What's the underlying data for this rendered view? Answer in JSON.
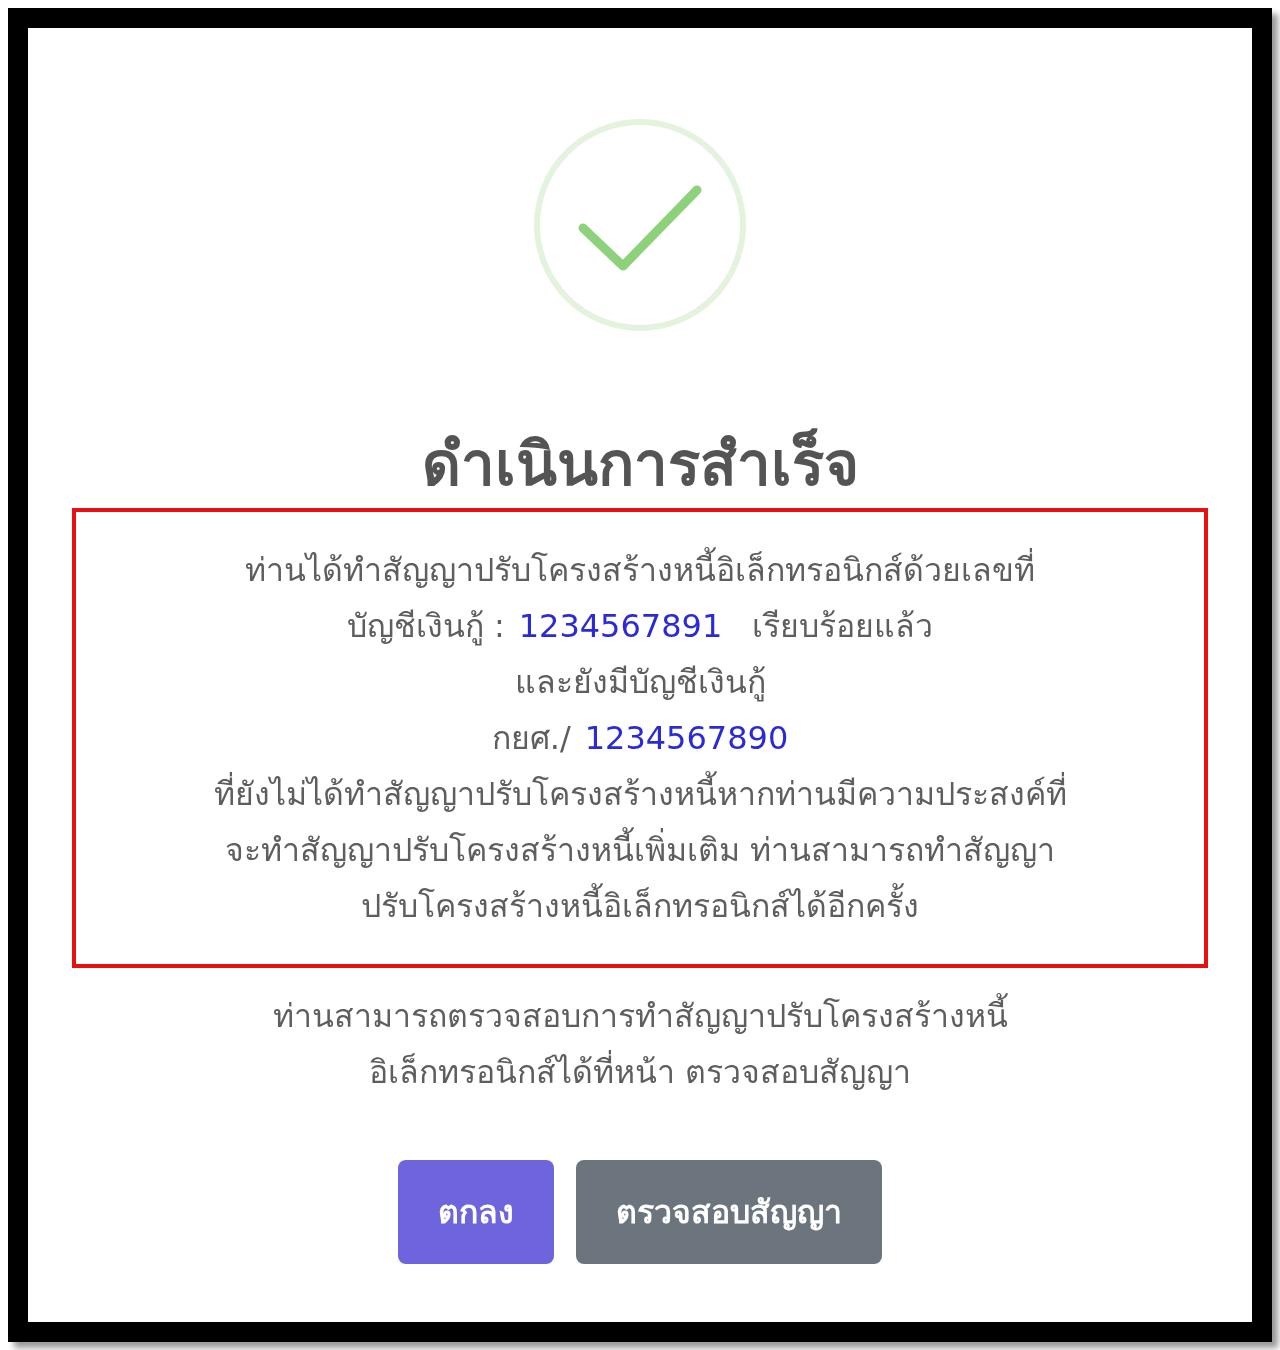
{
  "dialog": {
    "title": "ดำเนินการสำเร็จ",
    "notice_lines": [
      {
        "kind": "text",
        "text": "ท่านได้ทำสัญญาปรับโครงสร้างหนี้อิเล็กทรอนิกส์ด้วยเลขที่"
      },
      {
        "kind": "account",
        "label": "บัญชีเงินกู้ :",
        "number": "1234567891",
        "suffix": "เรียบร้อยแล้ว"
      },
      {
        "kind": "text",
        "text": "และยังมีบัญชีเงินกู้"
      },
      {
        "kind": "account",
        "label": "กยศ./",
        "number": "1234567890"
      },
      {
        "kind": "text",
        "text": "ที่ยังไม่ได้ทำสัญญาปรับโครงสร้างหนี้หากท่านมีความประสงค์ที่"
      },
      {
        "kind": "text",
        "text": "จะทำสัญญาปรับโครงสร้างหนี้เพิ่มเติม ท่านสามารถทำสัญญา"
      },
      {
        "kind": "text",
        "text": "ปรับโครงสร้างหนี้อิเล็กทรอนิกส์ได้อีกครั้ง"
      }
    ],
    "footer_lines": [
      "ท่านสามารถตรวจสอบการทำสัญญาปรับโครงสร้างหนี้",
      "อิเล็กทรอนิกส์ได้ที่หน้า ตรวจสอบสัญญา"
    ],
    "buttons": [
      {
        "label": "ตกลง",
        "kind": "primary"
      },
      {
        "label": "ตรวจสอบสัญญา",
        "kind": "secondary"
      }
    ]
  }
}
